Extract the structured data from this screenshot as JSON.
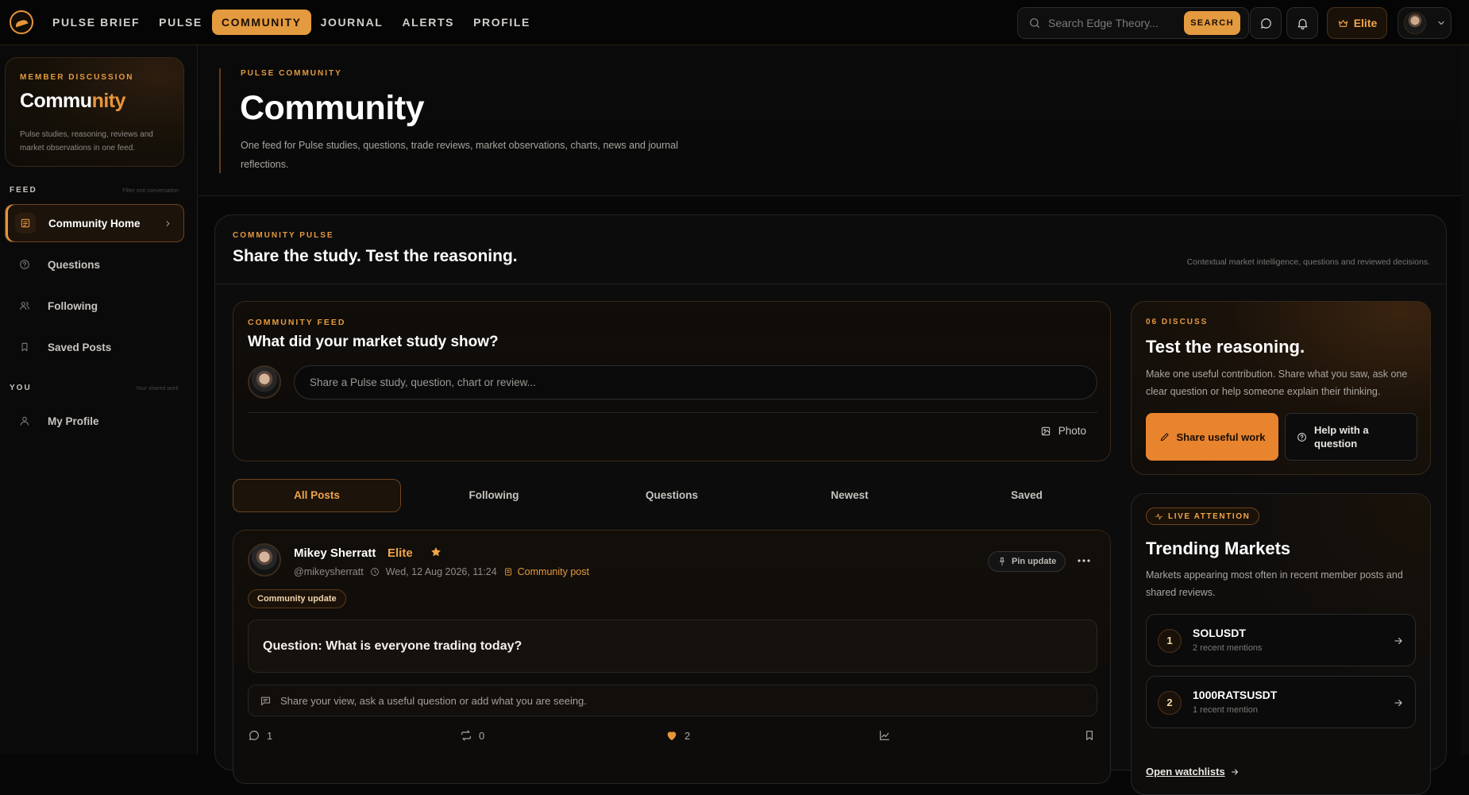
{
  "nav": {
    "links": [
      "PULSE BRIEF",
      "PULSE",
      "COMMUNITY",
      "JOURNAL",
      "ALERTS",
      "PROFILE"
    ],
    "active": "COMMUNITY",
    "search_placeholder": "Search Edge Theory...",
    "search_button": "SEARCH",
    "elite_label": "Elite"
  },
  "sidebar": {
    "card": {
      "kicker": "MEMBER DISCUSSION",
      "title_a": "Commu",
      "title_b": "nity",
      "desc": "Pulse studies, reasoning, reviews and market observations in one feed."
    },
    "feed_label": "FEED",
    "feed_hint": "Filter one conversation",
    "feed_items": [
      {
        "label": "Community Home",
        "icon": "feed-icon",
        "active": true
      },
      {
        "label": "Questions",
        "icon": "question-icon",
        "active": false
      },
      {
        "label": "Following",
        "icon": "users-icon",
        "active": false
      },
      {
        "label": "Saved Posts",
        "icon": "bookmark-icon",
        "active": false
      }
    ],
    "you_label": "YOU",
    "you_hint": "Your shared work",
    "you_items": [
      {
        "label": "My Profile",
        "icon": "user-icon"
      }
    ]
  },
  "hero": {
    "kicker": "PULSE COMMUNITY",
    "title": "Community",
    "desc": "One feed for Pulse studies, questions, trade reviews, market observations, charts, news and journal reflections."
  },
  "panel": {
    "kicker": "COMMUNITY PULSE",
    "title": "Share the study. Test the reasoning.",
    "note": "Contextual market intelligence, questions and reviewed decisions."
  },
  "composer": {
    "kicker": "COMMUNITY FEED",
    "title": "What did your market study show?",
    "placeholder": "Share a Pulse study, question, chart or review...",
    "photo_label": "Photo"
  },
  "tabs": [
    "All Posts",
    "Following",
    "Questions",
    "Newest",
    "Saved"
  ],
  "post": {
    "author": "Mikey Sherratt",
    "badge": "Elite",
    "handle": "@mikeysherratt",
    "timestamp": "Wed, 12 Aug 2026, 11:24",
    "type": "Community post",
    "tag": "Community update",
    "pin_label": "Pin update",
    "question": "Question: What is everyone trading today?",
    "reply_prompt": "Share your view, ask a useful question or add what you are seeing.",
    "comments": "1",
    "reposts": "0",
    "likes": "2"
  },
  "discuss": {
    "kicker": "06 DISCUSS",
    "title": "Test the reasoning.",
    "desc": "Make one useful contribution. Share what you saw, ask one clear question or help someone explain their thinking.",
    "primary_button": "Share useful work",
    "secondary_button": "Help with a question"
  },
  "trending": {
    "badge": "LIVE ATTENTION",
    "title": "Trending Markets",
    "desc": "Markets appearing most often in recent member posts and shared reviews.",
    "markets": [
      {
        "rank": "1",
        "symbol": "SOLUSDT",
        "mentions": "2 recent mentions"
      },
      {
        "rank": "2",
        "symbol": "1000RATSUSDT",
        "mentions": "1 recent mention"
      }
    ],
    "link": "Open watchlists"
  },
  "colors": {
    "accent": "#e49a3f",
    "accent_strong": "#e8832e",
    "background": "#070707"
  }
}
